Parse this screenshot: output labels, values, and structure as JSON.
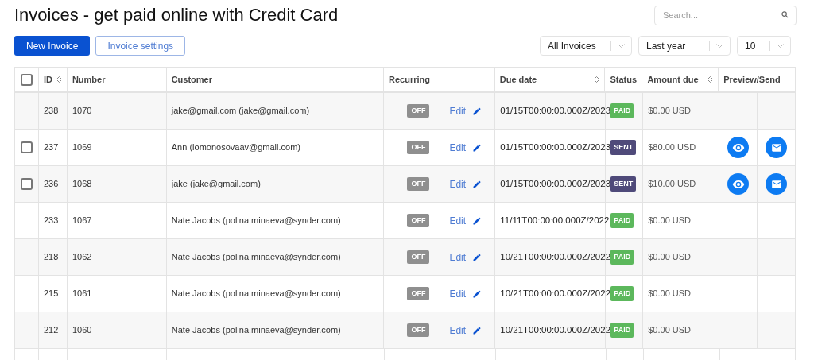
{
  "title": "Invoices - get paid online with Credit Card",
  "search": {
    "placeholder": "Search..."
  },
  "buttons": {
    "primary": "New Invoice",
    "secondary": "Invoice settings"
  },
  "filters": [
    {
      "value": "All Invoices"
    },
    {
      "value": "Last year"
    },
    {
      "value": "10"
    }
  ],
  "table": {
    "select_all": {
      "checked": false
    },
    "columns": [
      {
        "label": "ID",
        "sortable": true
      },
      {
        "label": "Number",
        "sortable": false
      },
      {
        "label": "Customer",
        "sortable": false
      },
      {
        "label": "Recurring",
        "sortable": false
      },
      {
        "label": "Due date",
        "sortable": true
      },
      {
        "label": "Status",
        "sortable": false
      },
      {
        "label": "Amount due",
        "sortable": true
      },
      {
        "label": "Preview/Send",
        "sortable": false
      }
    ],
    "rows": [
      {
        "selectable": false,
        "checked": false,
        "id": "238",
        "number": "1070",
        "customer": "jake@gmail.com (jake@gmail.com)",
        "recurring": {
          "label": "OFF",
          "on": false
        },
        "edit": "Edit",
        "due": "01/15T00:00:00.000Z/2023",
        "status": {
          "label": "PAID",
          "kind": "paid"
        },
        "amount": "$0.00 USD",
        "actions": false
      },
      {
        "selectable": true,
        "checked": false,
        "id": "237",
        "number": "1069",
        "customer": "Ann (lomonosovaav@gmail.com)",
        "recurring": {
          "label": "OFF",
          "on": false
        },
        "edit": "Edit",
        "due": "01/15T00:00:00.000Z/2023",
        "status": {
          "label": "SENT",
          "kind": "sent"
        },
        "amount": "$80.00 USD",
        "actions": true
      },
      {
        "selectable": true,
        "checked": false,
        "id": "236",
        "number": "1068",
        "customer": "jake (jake@gmail.com)",
        "recurring": {
          "label": "OFF",
          "on": false
        },
        "edit": "Edit",
        "due": "01/15T00:00:00.000Z/2023",
        "status": {
          "label": "SENT",
          "kind": "sent"
        },
        "amount": "$10.00 USD",
        "actions": true
      },
      {
        "selectable": false,
        "checked": false,
        "id": "233",
        "number": "1067",
        "customer": "Nate Jacobs (polina.minaeva@synder.com)",
        "recurring": {
          "label": "OFF",
          "on": false
        },
        "edit": "Edit",
        "due": "11/11T00:00:00.000Z/2022",
        "status": {
          "label": "PAID",
          "kind": "paid"
        },
        "amount": "$0.00 USD",
        "actions": false
      },
      {
        "selectable": false,
        "checked": false,
        "id": "218",
        "number": "1062",
        "customer": "Nate Jacobs (polina.minaeva@synder.com)",
        "recurring": {
          "label": "OFF",
          "on": false
        },
        "edit": "Edit",
        "due": "10/21T00:00:00.000Z/2022",
        "status": {
          "label": "PAID",
          "kind": "paid"
        },
        "amount": "$0.00 USD",
        "actions": false
      },
      {
        "selectable": false,
        "checked": false,
        "id": "215",
        "number": "1061",
        "customer": "Nate Jacobs (polina.minaeva@synder.com)",
        "recurring": {
          "label": "OFF",
          "on": false
        },
        "edit": "Edit",
        "due": "10/21T00:00:00.000Z/2022",
        "status": {
          "label": "PAID",
          "kind": "paid"
        },
        "amount": "$0.00 USD",
        "actions": false
      },
      {
        "selectable": false,
        "checked": false,
        "id": "212",
        "number": "1060",
        "customer": "Nate Jacobs (polina.minaeva@synder.com)",
        "recurring": {
          "label": "OFF",
          "on": false
        },
        "edit": "Edit",
        "due": "10/21T00:00:00.000Z/2022",
        "status": {
          "label": "PAID",
          "kind": "paid"
        },
        "amount": "$0.00 USD",
        "actions": false
      }
    ]
  }
}
